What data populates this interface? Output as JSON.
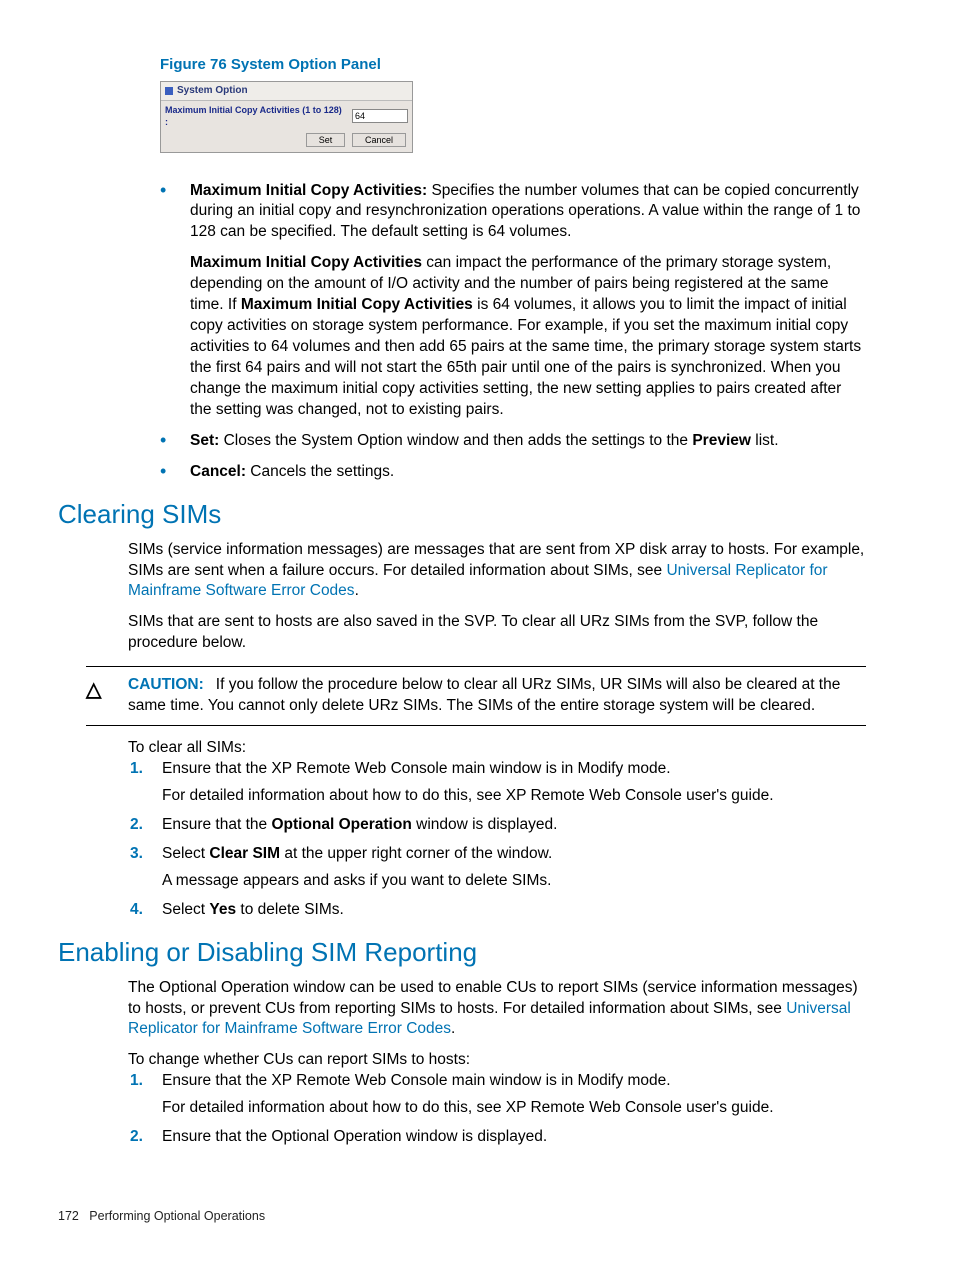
{
  "figure": {
    "caption": "Figure 76 System Option Panel",
    "title": "System Option",
    "label": "Maximum Initial Copy Activities (1 to 128) :",
    "value": "64",
    "set": "Set",
    "cancel": "Cancel"
  },
  "bullets": {
    "b1_bold": "Maximum Initial Copy Activities:",
    "b1_text": " Specifies the number volumes that can be copied concurrently during an initial copy and resynchronization operations operations. A value within the range of 1 to 128 can be specified. The default setting is 64 volumes.",
    "b1_para_a": "Maximum Initial Copy Activities",
    "b1_para_b": " can impact the performance of the primary storage system, depending on the amount of I/O activity and the number of pairs being registered at the same time. If ",
    "b1_para_c": "Maximum Initial Copy Activities",
    "b1_para_d": " is 64 volumes, it allows you to limit the impact of initial copy activities on storage system performance. For example, if you set the maximum initial copy activities to 64 volumes and then add 65 pairs at the same time, the primary storage system starts the first 64 pairs and will not start the 65th pair until one of the pairs is synchronized. When you change the maximum initial copy activities setting, the new setting applies to pairs created after the setting was changed, not to existing pairs.",
    "b2_bold": "Set:",
    "b2_a": " Closes the System Option window and then adds the settings to the ",
    "b2_b": "Preview",
    "b2_c": " list.",
    "b3_bold": "Cancel:",
    "b3_text": " Cancels the settings."
  },
  "clearing": {
    "heading": "Clearing SIMs",
    "p1a": "SIMs (service information messages) are messages that are sent from XP disk array to hosts. For example, SIMs are sent when a failure occurs. For detailed information about SIMs, see ",
    "p1link": "Universal Replicator for Mainframe Software Error Codes",
    "p1b": ".",
    "p2": "SIMs that are sent to hosts are also saved in the SVP. To clear all URz SIMs from the SVP, follow the procedure below.",
    "caution_icon": "△",
    "caution_label": "CAUTION:",
    "caution_text": "If you follow the procedure below to clear all URz SIMs, UR SIMs will also be cleared at the same time. You cannot only delete URz SIMs. The SIMs of the entire storage system will be cleared.",
    "lead": "To clear all SIMs:",
    "s1": "Ensure that the XP Remote Web Console main window is in Modify mode.",
    "s1_sub": "For detailed information about how to do this, see XP Remote Web Console user's guide.",
    "s2a": "Ensure that the ",
    "s2b": "Optional Operation",
    "s2c": " window is displayed.",
    "s3a": "Select ",
    "s3b": "Clear SIM",
    "s3c": " at the upper right corner of the window.",
    "s3_sub": "A message appears and asks if you want to delete SIMs.",
    "s4a": "Select ",
    "s4b": "Yes",
    "s4c": " to delete SIMs."
  },
  "enabling": {
    "heading": "Enabling or Disabling SIM Reporting",
    "p1a": "The Optional Operation window can be used to enable CUs to report SIMs (service information messages) to hosts, or prevent CUs from reporting SIMs to hosts. For detailed information about SIMs, see ",
    "p1link": "Universal Replicator for Mainframe Software Error Codes",
    "p1b": ".",
    "lead": "To change whether CUs can report SIMs to hosts:",
    "s1": "Ensure that the XP Remote Web Console main window is in Modify mode.",
    "s1_sub": "For detailed information about how to do this, see XP Remote Web Console user's guide.",
    "s2": "Ensure that the Optional Operation window is displayed."
  },
  "footer": {
    "page": "172",
    "title": "Performing Optional Operations"
  }
}
